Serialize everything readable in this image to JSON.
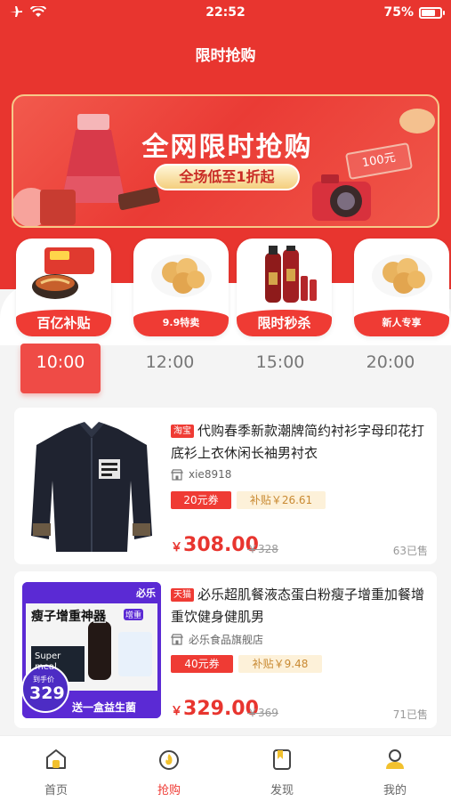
{
  "status_bar": {
    "time": "22:52",
    "battery_percent": "75%",
    "battery_level": 0.75
  },
  "header": {
    "title": "限时抢购"
  },
  "banner": {
    "title": "全网限时抢购",
    "subtitle": "全场低至1折起",
    "price_tag": "100元"
  },
  "categories": [
    {
      "label": "百亿补贴",
      "icon": "instant-noodle-icon"
    },
    {
      "label": "9.9特卖",
      "icon": "pastry-icon"
    },
    {
      "label": "限时秒杀",
      "icon": "shampoo-icon"
    },
    {
      "label": "新人专享",
      "icon": "pastry-icon"
    }
  ],
  "time_tabs": [
    {
      "label": "10:00",
      "active": true
    },
    {
      "label": "12:00",
      "active": false
    },
    {
      "label": "15:00",
      "active": false
    },
    {
      "label": "20:00",
      "active": false
    }
  ],
  "products": [
    {
      "source": "淘宝",
      "title": "代购春季新款潮牌简约衬衫字母印花打底衫上衣休闲长袖男衬衣",
      "shop": "xie8918",
      "coupon": "20元券",
      "subsidy": "补贴￥26.61",
      "currency": "￥",
      "price": "308.00",
      "original_price": "￥328",
      "sold": "63已售"
    },
    {
      "source": "天猫",
      "title": "必乐超肌餐液态蛋白粉瘦子增重加餐增重饮健身健肌男",
      "shop": "必乐食品旗舰店",
      "coupon": "40元券",
      "subsidy": "补贴￥9.48",
      "currency": "￥",
      "price": "329.00",
      "original_price": "￥369",
      "sold": "71已售",
      "image_text": {
        "brand": "必乐",
        "headline": "瘦子增重神器",
        "side_label": "增重",
        "package_brand": "Super meal",
        "price_label": "到手价",
        "price_value": "329",
        "bottom_text": "送一盒益生菌"
      }
    }
  ],
  "tabbar": [
    {
      "label": "首页",
      "active": false
    },
    {
      "label": "抢购",
      "active": true
    },
    {
      "label": "发现",
      "active": false
    },
    {
      "label": "我的",
      "active": false
    }
  ],
  "colors": {
    "brand_red": "#e8352f",
    "accent_red": "#ef3b34",
    "gold": "#f4cf7e"
  }
}
